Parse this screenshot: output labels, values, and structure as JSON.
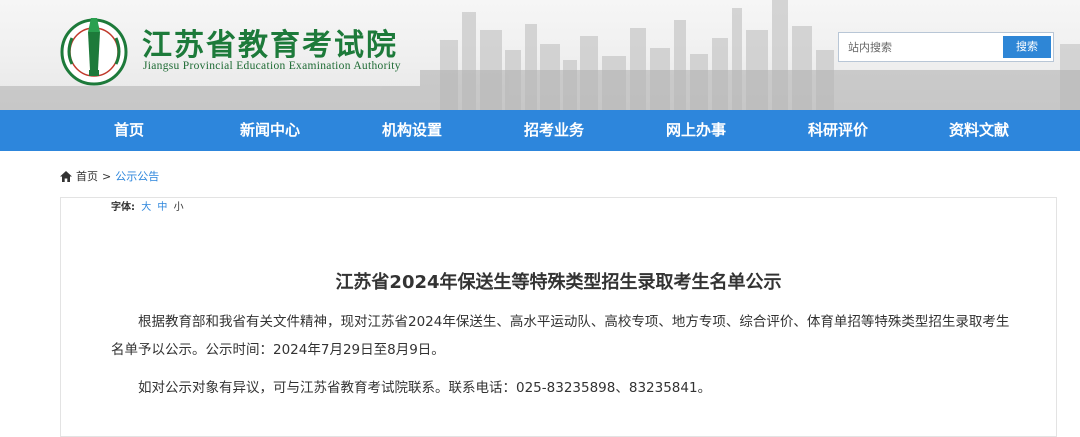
{
  "header": {
    "title_cn": "江苏省教育考试院",
    "title_en": "Jiangsu Provincial Education Examination Authority"
  },
  "search": {
    "placeholder": "站内搜索",
    "button_label": "搜索"
  },
  "nav": {
    "items": [
      {
        "label": "首页"
      },
      {
        "label": "新闻中心"
      },
      {
        "label": "机构设置"
      },
      {
        "label": "招考业务"
      },
      {
        "label": "网上办事"
      },
      {
        "label": "科研评价"
      },
      {
        "label": "资料文献"
      }
    ]
  },
  "breadcrumb": {
    "home": "首页",
    "separator": ">",
    "current": "公示公告"
  },
  "font_size": {
    "label": "字体:",
    "large": "大",
    "medium": "中",
    "small": "小"
  },
  "article": {
    "title": "江苏省2024年保送生等特殊类型招生录取考生名单公示",
    "paragraph1": "根据教育部和我省有关文件精神，现对江苏省2024年保送生、高水平运动队、高校专项、地方专项、综合评价、体育单招等特殊类型招生录取考生名单予以公示。公示时间：2024年7月29日至8月9日。",
    "paragraph2": "如对公示对象有异议，可与江苏省教育考试院联系。联系电话：025-83235898、83235841。"
  },
  "colors": {
    "nav_bg": "#2d86dc",
    "brand_green": "#1d7a3a",
    "link_blue": "#2d86dc"
  }
}
